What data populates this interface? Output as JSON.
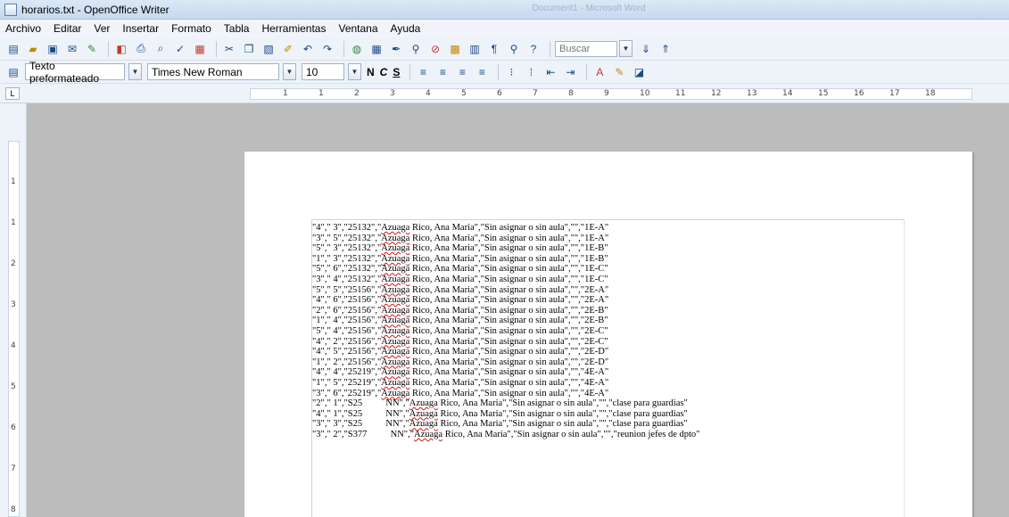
{
  "window": {
    "title": "horarios.txt - OpenOffice Writer",
    "ghost_title": "Document1 - Microsoft Word"
  },
  "menu": [
    "Archivo",
    "Editar",
    "Ver",
    "Insertar",
    "Formato",
    "Tabla",
    "Herramientas",
    "Ventana",
    "Ayuda"
  ],
  "toolbar": {
    "search_placeholder": "Buscar"
  },
  "format_bar": {
    "paragraph_style": "Texto preformateado",
    "font_name": "Times New Roman",
    "font_size": "10",
    "bold_label": "N",
    "italic_label": "C",
    "underline_label": "S"
  },
  "ruler": {
    "ticks": [
      "1",
      "1",
      "2",
      "3",
      "4",
      "5",
      "6",
      "7",
      "8",
      "9",
      "10",
      "11",
      "12",
      "13",
      "14",
      "15",
      "16",
      "17",
      "18"
    ],
    "vticks": [
      "1",
      "1",
      "2",
      "3",
      "4",
      "5",
      "6",
      "7",
      "8"
    ]
  },
  "document": {
    "lines": [
      {
        "pre": "\"4\",\" 3\",\"25132\",\"",
        "name": "Azuaga",
        "post": " Rico, Ana Maria\",\"Sin asignar o sin aula\",\"\",\"1E-A\""
      },
      {
        "pre": "\"3\",\" 5\",\"25132\",\"",
        "name": "Azuaga",
        "post": " Rico, Ana Maria\",\"Sin asignar o sin aula\",\"\",\"1E-A\""
      },
      {
        "pre": "\"5\",\" 3\",\"25132\",\"",
        "name": "Azuaga",
        "post": " Rico, Ana Maria\",\"Sin asignar o sin aula\",\"\",\"1E-B\""
      },
      {
        "pre": "\"1\",\" 3\",\"25132\",\"",
        "name": "Azuaga",
        "post": " Rico, Ana Maria\",\"Sin asignar o sin aula\",\"\",\"1E-B\""
      },
      {
        "pre": "\"5\",\" 6\",\"25132\",\"",
        "name": "Azuaga",
        "post": " Rico, Ana Maria\",\"Sin asignar o sin aula\",\"\",\"1E-C\""
      },
      {
        "pre": "\"3\",\" 4\",\"25132\",\"",
        "name": "Azuaga",
        "post": " Rico, Ana Maria\",\"Sin asignar o sin aula\",\"\",\"1E-C\""
      },
      {
        "pre": "\"5\",\" 5\",\"25156\",\"",
        "name": "Azuaga",
        "post": " Rico, Ana Maria\",\"Sin asignar o sin aula\",\"\",\"2E-A\""
      },
      {
        "pre": "\"4\",\" 6\",\"25156\",\"",
        "name": "Azuaga",
        "post": " Rico, Ana Maria\",\"Sin asignar o sin aula\",\"\",\"2E-A\""
      },
      {
        "pre": "\"2\",\" 6\",\"25156\",\"",
        "name": "Azuaga",
        "post": " Rico, Ana Maria\",\"Sin asignar o sin aula\",\"\",\"2E-B\""
      },
      {
        "pre": "\"1\",\" 4\",\"25156\",\"",
        "name": "Azuaga",
        "post": " Rico, Ana Maria\",\"Sin asignar o sin aula\",\"\",\"2E-B\""
      },
      {
        "pre": "\"5\",\" 4\",\"25156\",\"",
        "name": "Azuaga",
        "post": " Rico, Ana Maria\",\"Sin asignar o sin aula\",\"\",\"2E-C\""
      },
      {
        "pre": "\"4\",\" 2\",\"25156\",\"",
        "name": "Azuaga",
        "post": " Rico, Ana Maria\",\"Sin asignar o sin aula\",\"\",\"2E-C\""
      },
      {
        "pre": "\"4\",\" 5\",\"25156\",\"",
        "name": "Azuaga",
        "post": " Rico, Ana Maria\",\"Sin asignar o sin aula\",\"\",\"2E-D\""
      },
      {
        "pre": "\"1\",\" 2\",\"25156\",\"",
        "name": "Azuaga",
        "post": " Rico, Ana Maria\",\"Sin asignar o sin aula\",\"\",\"2E-D\""
      },
      {
        "pre": "\"4\",\" 4\",\"25219\",\"",
        "name": "Azuaga",
        "post": " Rico, Ana Maria\",\"Sin asignar o sin aula\",\"\",\"4E-A\""
      },
      {
        "pre": "\"1\",\" 5\",\"25219\",\"",
        "name": "Azuaga",
        "post": " Rico, Ana Maria\",\"Sin asignar o sin aula\",\"\",\"4E-A\""
      },
      {
        "pre": "\"3\",\" 6\",\"25219\",\"",
        "name": "Azuaga",
        "post": " Rico, Ana Maria\",\"Sin asignar o sin aula\",\"\",\"4E-A\""
      },
      {
        "pre": "\"2\",\" 1\",\"S25          NN\",\"",
        "name": "Azuaga",
        "post": " Rico, Ana Maria\",\"Sin asignar o sin aula\",\"\",\"clase para guardias\""
      },
      {
        "pre": "\"4\",\" 1\",\"S25          NN\",\"",
        "name": "Azuaga",
        "post": " Rico, Ana Maria\",\"Sin asignar o sin aula\",\"\",\"clase para guardias\""
      },
      {
        "pre": "\"3\",\" 3\",\"S25          NN\",\"",
        "name": "Azuaga",
        "post": " Rico, Ana Maria\",\"Sin asignar o sin aula\",\"\",\"clase para guardias\""
      },
      {
        "pre": "\"3\",\" 2\",\"S377          NN\",\"",
        "name": "Azuaga",
        "post": " Rico, Ana Maria\",\"Sin asignar o sin aula\",\"\",\"reunion jefes de dpto\""
      }
    ]
  },
  "colors": {
    "spellcheck": "#dd1111",
    "canvas": "#bcbcbc"
  }
}
